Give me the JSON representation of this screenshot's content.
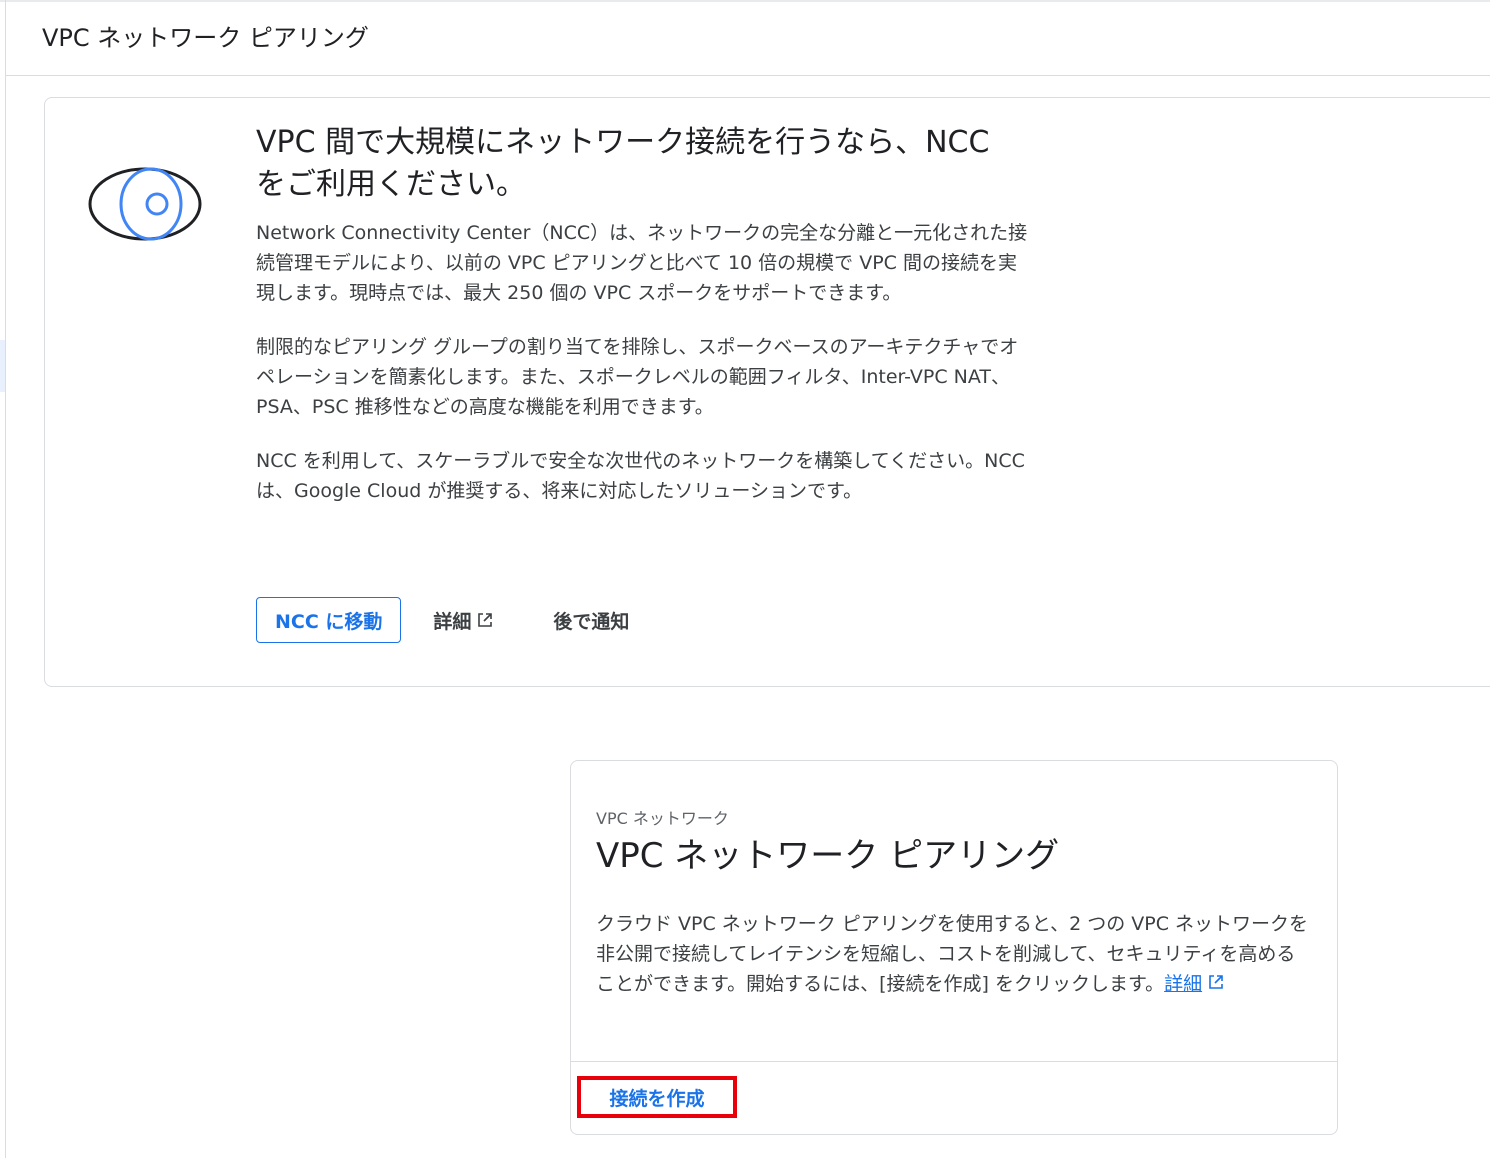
{
  "header": {
    "title": "VPC ネットワーク ピアリング"
  },
  "promo": {
    "icon": "ncc-eye-illustration",
    "title": "VPC 間で大規模にネットワーク接続を行うなら、NCC をご利用ください。",
    "paragraphs": [
      "Network Connectivity Center（NCC）は、ネットワークの完全な分離と一元化された接続管理モデルにより、以前の VPC ピアリングと比べて 10 倍の規模で VPC 間の接続を実現します。現時点では、最大 250 個の VPC スポークをサポートできます。",
      "制限的なピアリング グループの割り当てを排除し、スポークベースのアーキテクチャでオペレーションを簡素化します。また、スポークレベルの範囲フィルタ、Inter-VPC NAT、PSA、PSC 推移性などの高度な機能を利用できます。",
      "NCC を利用して、スケーラブルで安全な次世代のネットワークを構築してください。NCC は、Google Cloud が推奨する、将来に対応したソリューションです。"
    ],
    "actions": {
      "go_ncc": "NCC に移動",
      "details": "詳細",
      "later": "後で通知"
    }
  },
  "peering_card": {
    "eyebrow": "VPC ネットワーク",
    "title": "VPC ネットワーク ピアリング",
    "description": "クラウド VPC ネットワーク ピアリングを使用すると、2 つの VPC ネットワークを非公開で接続してレイテンシを短縮し、コストを削減して、セキュリティを高めることができます。開始するには、[接続を作成] をクリックします。",
    "details_link": "詳細",
    "create_button": "接続を作成"
  },
  "colors": {
    "accent": "#1a73e8",
    "highlight_border": "#e8000b",
    "border": "#dadce0"
  }
}
